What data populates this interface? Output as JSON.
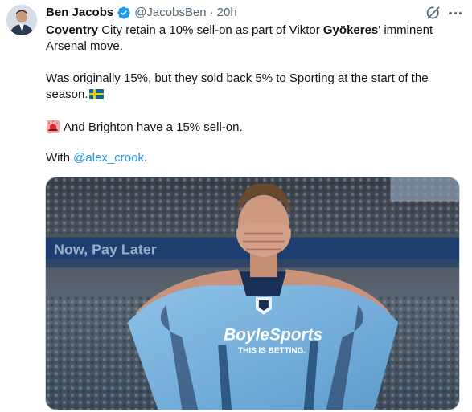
{
  "author": {
    "name": "Ben Jacobs",
    "handle": "@JacobsBen",
    "separator": "·",
    "time": "20h"
  },
  "tweet": {
    "line1_bold": "Coventry",
    "line1_a": " City retain a 10% sell-on as part of Viktor ",
    "line1_bold2": "Gyökeres",
    "line1_b": "' imminent Arsenal move.",
    "para2": "Was originally 15%, but they sold back 5% to Sporting at the start of the season.",
    "para3": "And Brighton have a 15% sell-on.",
    "para4_prefix": "With ",
    "mention": "@alex_crook",
    "para4_suffix": "."
  },
  "media": {
    "stand_sign": "Now, Pay Later",
    "sponsor": "BoyleSports",
    "sponsor_tagline": "THIS IS BETTING."
  },
  "icons": {
    "verified": "verified-badge-icon",
    "grok": "grok-icon",
    "more": "more-options-icon",
    "flag": "sweden-flag-icon",
    "siren": "siren-icon"
  },
  "colors": {
    "link": "#1d9bf0",
    "verified": "#1d9bf0",
    "kit": "#7fb6e0",
    "secondary_text": "#536471"
  }
}
